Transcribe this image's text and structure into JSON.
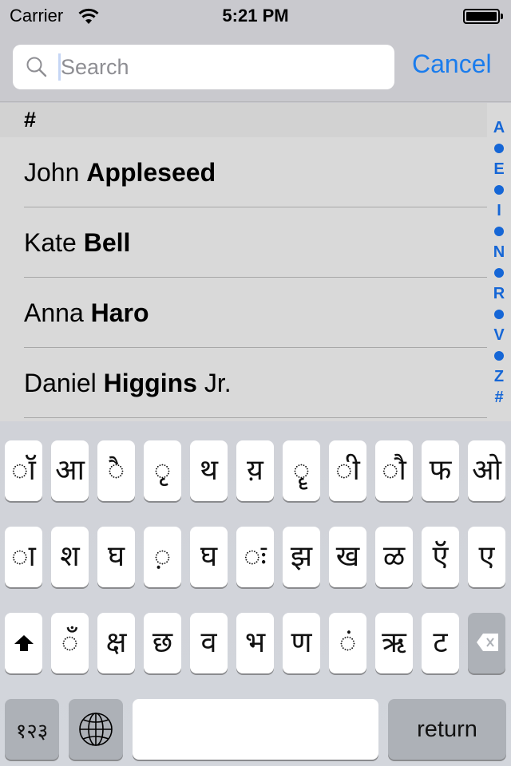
{
  "status_bar": {
    "carrier": "Carrier",
    "time": "5:21 PM",
    "wifi_icon": "wifi-icon",
    "battery_icon": "battery-full-icon"
  },
  "search": {
    "placeholder": "Search",
    "value": "",
    "cancel_label": "Cancel",
    "icon": "search-icon"
  },
  "list": {
    "section_header": "#",
    "contacts": [
      {
        "first": "John",
        "last": "Appleseed",
        "suffix": ""
      },
      {
        "first": "Kate",
        "last": "Bell",
        "suffix": ""
      },
      {
        "first": "Anna",
        "last": "Haro",
        "suffix": ""
      },
      {
        "first": "Daniel",
        "last": "Higgins",
        "suffix": "Jr."
      }
    ],
    "index": [
      "A",
      "•",
      "E",
      "•",
      "I",
      "•",
      "N",
      "•",
      "R",
      "•",
      "V",
      "•",
      "Z",
      "#"
    ]
  },
  "keyboard": {
    "row1": [
      "◌ॉ",
      "आ",
      "◌ै",
      "◌ृ",
      "थ",
      "य़",
      "◌ॄ",
      "◌ी",
      "◌ौ",
      "फ",
      "ओ"
    ],
    "row2": [
      "◌ा",
      "श",
      "घ",
      "◌़",
      "घ",
      "◌ः",
      "झ",
      "ख",
      "ळ",
      "ऍ",
      "ए"
    ],
    "row3": [
      "◌ँ",
      "क्ष",
      "छ",
      "व",
      "भ",
      "ण",
      "◌ं",
      "ऋ",
      "ट"
    ],
    "shift_icon": "shift-icon",
    "delete_icon": "delete-icon",
    "numbers_label": "१२३",
    "globe_icon": "globe-icon",
    "space_label": "",
    "return_label": "return"
  },
  "colors": {
    "accent": "#1a7ced",
    "index": "#1566d6",
    "background": "#c9c9ce",
    "list_background": "#d9d9d9"
  }
}
